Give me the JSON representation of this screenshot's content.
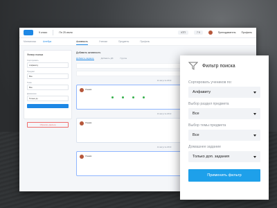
{
  "app": {
    "topbar": {
      "class_label": "9 класс",
      "date_label": "Пн 25 июля",
      "status_badge": "КТП",
      "count_badge": "7 9",
      "teacher_name": "Преподаватель",
      "profile": "Профиль"
    },
    "subbar": {
      "crumb_1": "Математика",
      "crumb_2": "Алгебра",
      "tabs": [
        "Активность",
        "Ученики",
        "Предметы",
        "Профиль"
      ]
    },
    "left_card": {
      "title": "Фильтр поиска",
      "fields": [
        {
          "label": "Сортировать",
          "value": "Алфавиту"
        },
        {
          "label": "Предмет",
          "value": "Все"
        },
        {
          "label": "Тема",
          "value": "Все"
        },
        {
          "label": "Домашнее",
          "value": "Только дз"
        }
      ],
      "reset_label": "Сбросить фильтр"
    },
    "main": {
      "title": "Добавить активность",
      "tabs": [
        "Добавить задание",
        "Добавить ДЗ",
        "Группа"
      ],
      "date_1": "12 августа 2019",
      "date_2": "13 августа 2019",
      "date_3": "14 августа 2019",
      "post_1_name": "Ученик",
      "post_2_name": "Ученик",
      "post_3_name": "Ученик"
    }
  },
  "filter_panel": {
    "title": "Фильтр поиска",
    "sort_label": "Сортировать учеников по:",
    "sort_value": "Алфавиту",
    "section_label": "Выбор раздел предмета",
    "section_value": "Все",
    "topic_label": "Выбор темы предмета",
    "topic_value": "Все",
    "homework_label": "Домашнее задание",
    "homework_value": "Только доп. задания",
    "apply_label": "Применить фильтр"
  },
  "colors": {
    "accent": "#1ea0ea",
    "danger": "#ef6c6c",
    "success": "#35b04a"
  }
}
